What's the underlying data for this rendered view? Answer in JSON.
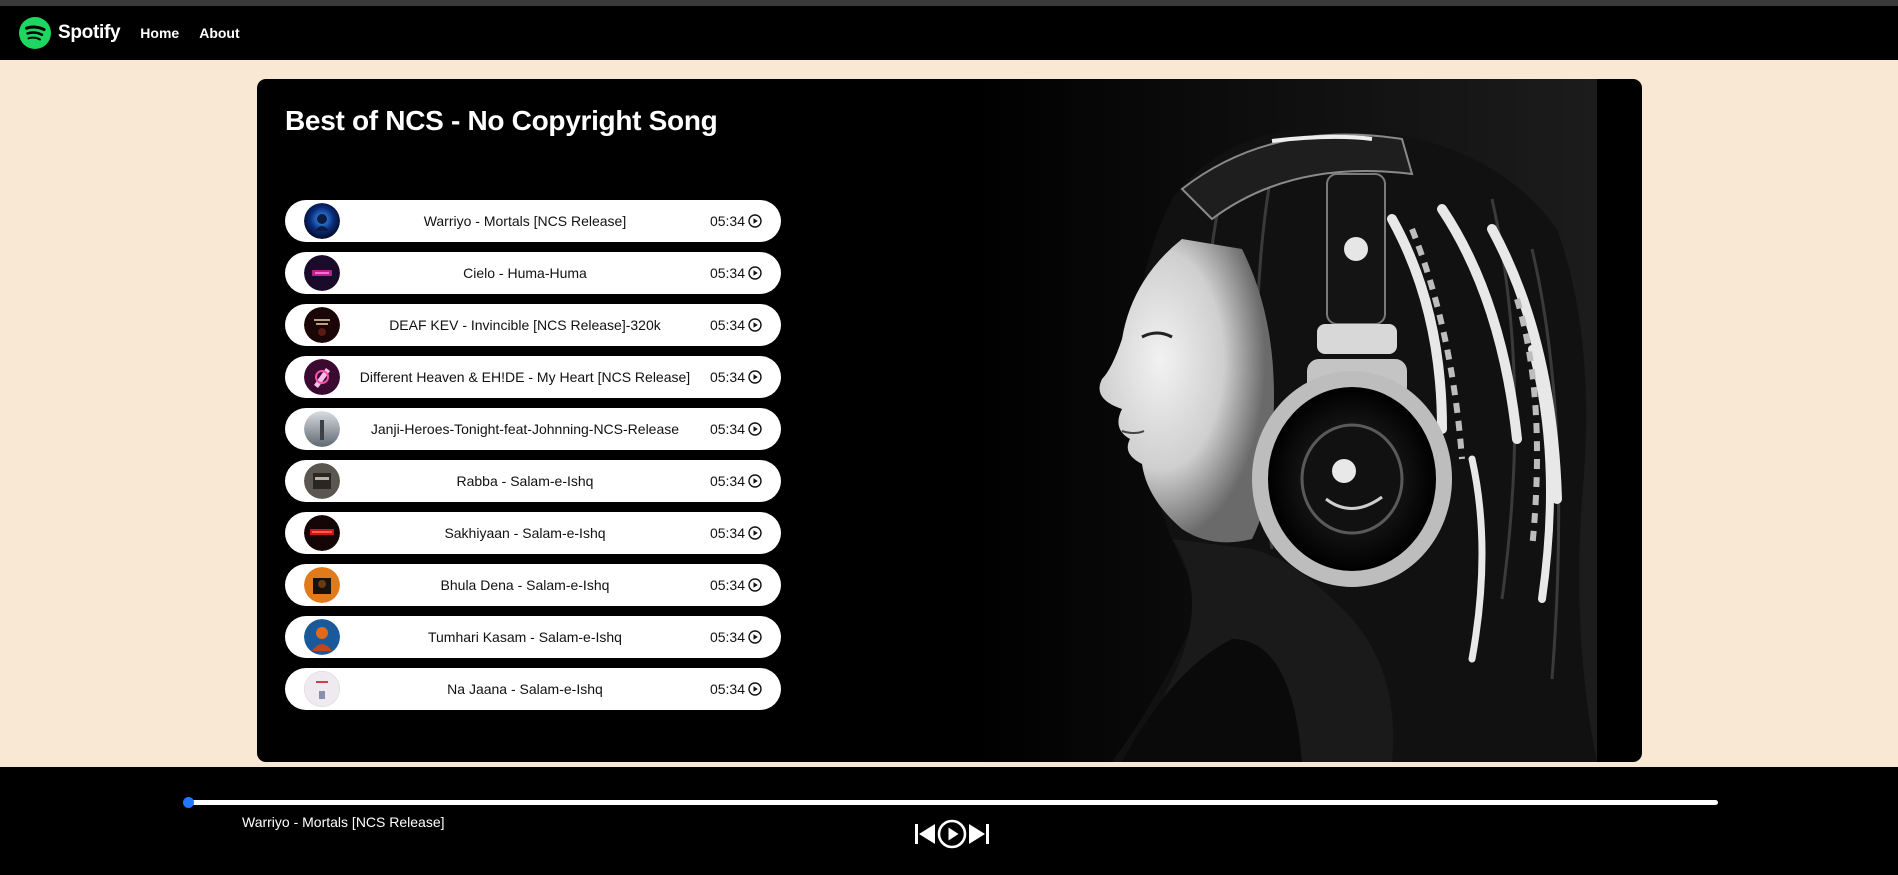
{
  "nav": {
    "brand": "Spotify",
    "links": [
      "Home",
      "About"
    ]
  },
  "playlist": {
    "title": "Best of NCS - No Copyright Song",
    "songs": [
      {
        "name": "Warriyo - Mortals [NCS Release]",
        "duration": "05:34"
      },
      {
        "name": "Cielo - Huma-Huma",
        "duration": "05:34"
      },
      {
        "name": "DEAF KEV - Invincible [NCS Release]-320k",
        "duration": "05:34"
      },
      {
        "name": "Different Heaven & EH!DE - My Heart [NCS Release]",
        "duration": "05:34"
      },
      {
        "name": "Janji-Heroes-Tonight-feat-Johnning-NCS-Release",
        "duration": "05:34"
      },
      {
        "name": "Rabba - Salam-e-Ishq",
        "duration": "05:34"
      },
      {
        "name": "Sakhiyaan - Salam-e-Ishq",
        "duration": "05:34"
      },
      {
        "name": "Bhula Dena - Salam-e-Ishq",
        "duration": "05:34"
      },
      {
        "name": "Tumhari Kasam - Salam-e-Ishq",
        "duration": "05:34"
      },
      {
        "name": "Na Jaana - Salam-e-Ishq",
        "duration": "05:34"
      }
    ]
  },
  "player": {
    "now_playing": "Warriyo - Mortals [NCS Release]",
    "progress": 0,
    "controls": [
      "previous-icon",
      "play-icon",
      "next-icon"
    ]
  },
  "colors": {
    "page_background": "#f8e8d4",
    "brand_green": "#1ed760",
    "progress_accent": "#1f78ff"
  }
}
